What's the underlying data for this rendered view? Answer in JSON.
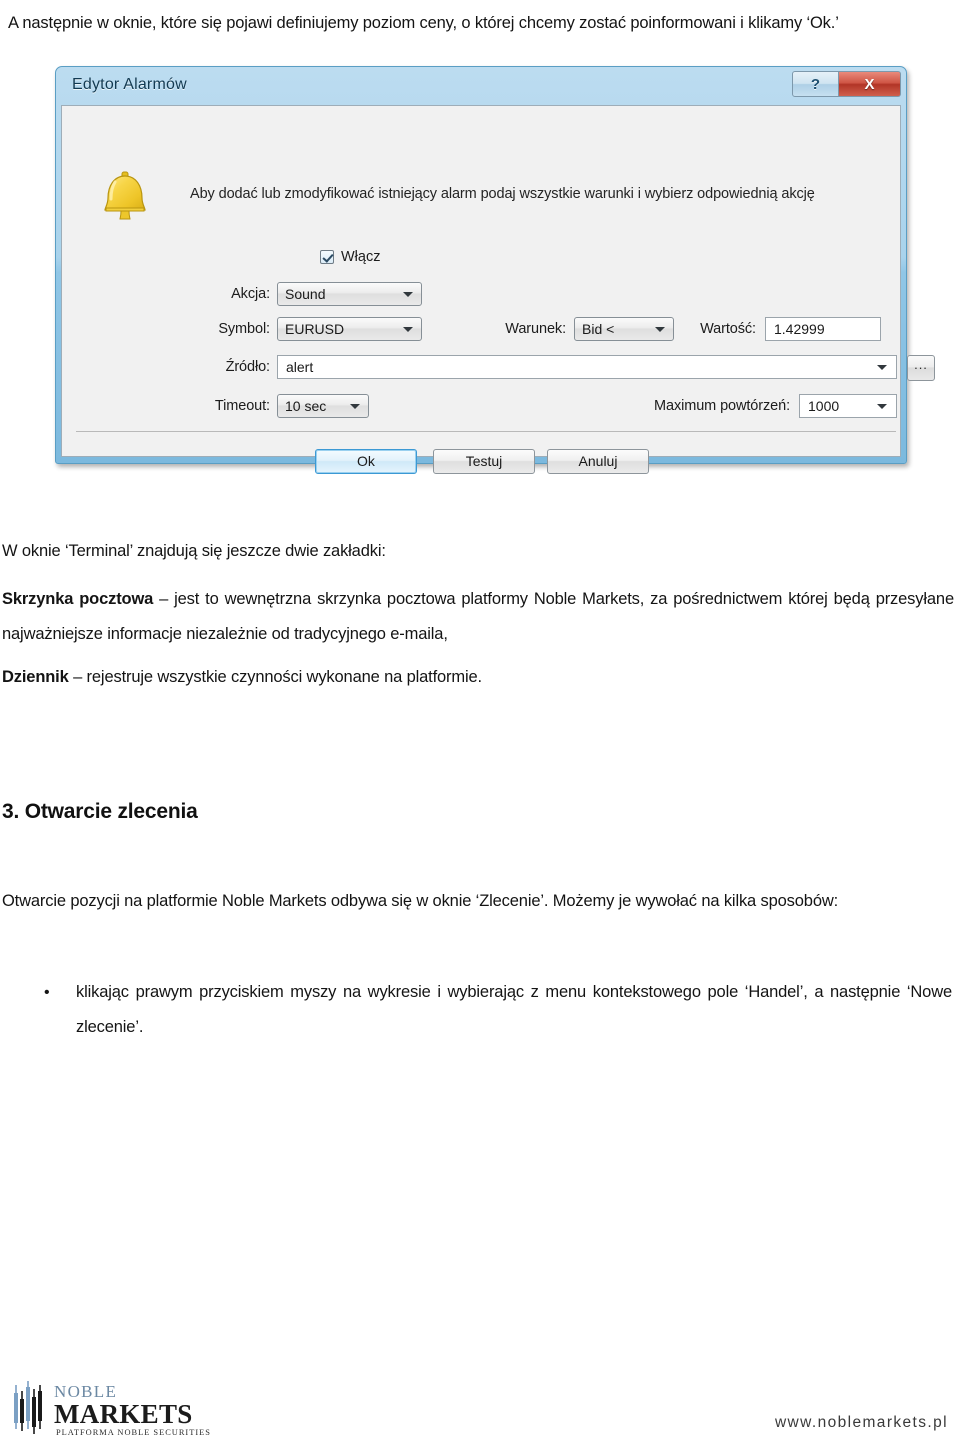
{
  "document": {
    "intro_paragraph": "A następnie w oknie, które się pojawi definiujemy poziom ceny, o której chcemy zostać poinformowani i klikamy ‘Ok.’",
    "terminal_paragraph": "W oknie ‘Terminal’ znajdują się jeszcze dwie zakładki:",
    "skrzynka_bold": "Skrzynka pocztowa",
    "skrzynka_rest": " – jest to wewnętrzna skrzynka pocztowa platformy Noble Markets, za pośrednictwem której będą przesyłane najważniejsze informacje niezależnie od tradycyjnego e-maila,",
    "dziennik_bold": "Dziennik",
    "dziennik_rest": " – rejestruje wszystkie czynności wykonane na platformie.",
    "section_heading": "3. Otwarcie zlecenia",
    "otwarcie_paragraph": "Otwarcie pozycji na platformie Noble Markets odbywa się w oknie ‘Zlecenie’. Możemy je wywołać na kilka sposobów:",
    "bullet_marker": "•",
    "bullet_items": [
      "klikając prawym przyciskiem myszy na wykresie i wybierając z menu kontekstowego pole ‘Handel’, a następnie ‘Nowe zlecenie’."
    ]
  },
  "dialog": {
    "title": "Edytor Alarmów",
    "help_button_label": "?",
    "close_button_label": "X",
    "instruction": "Aby dodać lub zmodyfikować istniejący alarm podaj wszystkie warunki i wybierz odpowiednią akcję",
    "bell_icon_name": "bell-icon",
    "enable_label": "Włącz",
    "enable_checked": true,
    "fields": {
      "akcja_label": "Akcja:",
      "akcja_value": "Sound",
      "symbol_label": "Symbol:",
      "symbol_value": "EURUSD",
      "warunek_label": "Warunek:",
      "warunek_value": "Bid <",
      "wartosc_label": "Wartość:",
      "wartosc_value": "1.42999",
      "zrodlo_label": "Źródło:",
      "zrodlo_value": "alert",
      "browse_label": "...",
      "timeout_label": "Timeout:",
      "timeout_value": "10 sec",
      "max_repeat_label": "Maximum powtórzeń:",
      "max_repeat_value": "1000"
    },
    "buttons": {
      "ok": "Ok",
      "test": "Testuj",
      "cancel": "Anuluj"
    },
    "colors": {
      "titlebar_blue": "#a9d3ec",
      "close_red": "#b23426",
      "body_gray": "#f1f1f1",
      "focus_blue": "#3c99d4"
    }
  },
  "footer": {
    "logo_line1": "NOBLE",
    "logo_line2": "MARKETS",
    "logo_tagline": "PLATFORMA NOBLE SECURITIES",
    "url": "www.noblemarkets.pl",
    "logo_colors": {
      "noble_blue": "#6b88a3",
      "markets_black": "#1b1b1b",
      "bar_blue": "#7ba0c4"
    }
  }
}
